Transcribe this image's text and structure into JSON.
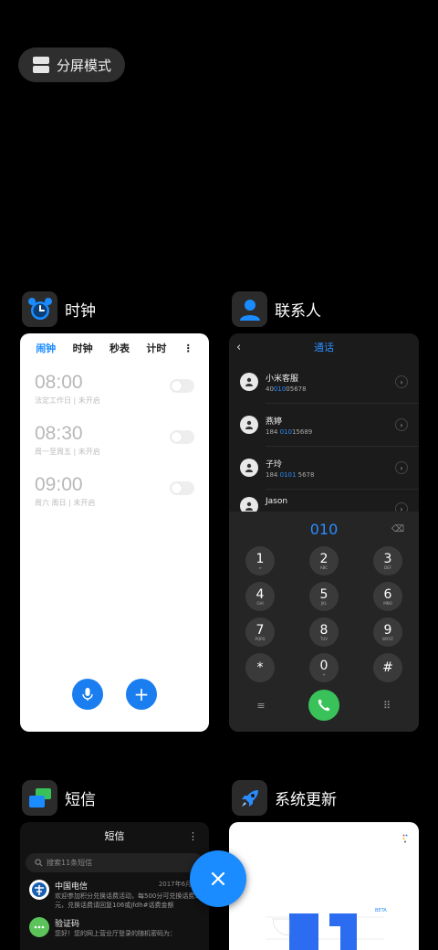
{
  "split_mode": {
    "label": "分屏模式"
  },
  "apps": {
    "clock": {
      "name": "时钟",
      "tabs": [
        "闹钟",
        "时钟",
        "秒表",
        "计时"
      ],
      "alarms": [
        {
          "time": "08:00",
          "info": "法定工作日 | 未开启"
        },
        {
          "time": "08:30",
          "info": "周一至周五 | 未开启"
        },
        {
          "time": "09:00",
          "info": "周六 周日 | 未开启"
        }
      ]
    },
    "contacts": {
      "name": "联系人",
      "title": "通话",
      "entries": [
        {
          "name": "小米客服",
          "num_pre": "40",
          "num_hl": "010",
          "num_post": "05678"
        },
        {
          "name": "燕婷",
          "num_pre": "184 ",
          "num_hl": "010",
          "num_post": "15689"
        },
        {
          "name": "子玲",
          "num_pre": "184 ",
          "num_hl": "0101",
          "num_post": " 5678"
        },
        {
          "name": "Jason",
          "num_pre": "",
          "num_hl": "",
          "num_post": ""
        }
      ],
      "dial_value": "010",
      "keys": [
        {
          "d": "1",
          "l": "∞"
        },
        {
          "d": "2",
          "l": "ABC"
        },
        {
          "d": "3",
          "l": "DEF"
        },
        {
          "d": "4",
          "l": "GHI"
        },
        {
          "d": "5",
          "l": "JKL"
        },
        {
          "d": "6",
          "l": "MNO"
        },
        {
          "d": "7",
          "l": "PQRS"
        },
        {
          "d": "8",
          "l": "TUV"
        },
        {
          "d": "9",
          "l": "WXYZ"
        },
        {
          "d": "*",
          "l": ""
        },
        {
          "d": "0",
          "l": "+"
        },
        {
          "d": "#",
          "l": ""
        }
      ]
    },
    "sms": {
      "name": "短信",
      "title": "短信",
      "search_placeholder": "搜索11条短信",
      "messages": [
        {
          "sender": "中国电信",
          "date": "2017年6月30",
          "body": "欢迎参加积分兑换话费活动，每500分可兑换话费5元，兑换话费请回复106或jfdh#话费金额"
        },
        {
          "sender": "验证码",
          "date": "",
          "body": "您好！您的网上营业厅登录的随机密码为："
        }
      ]
    },
    "update": {
      "name": "系统更新",
      "beta_label": "BETA"
    }
  },
  "colors": {
    "accent": "#1a8cff",
    "call_green": "#3ac25a"
  }
}
